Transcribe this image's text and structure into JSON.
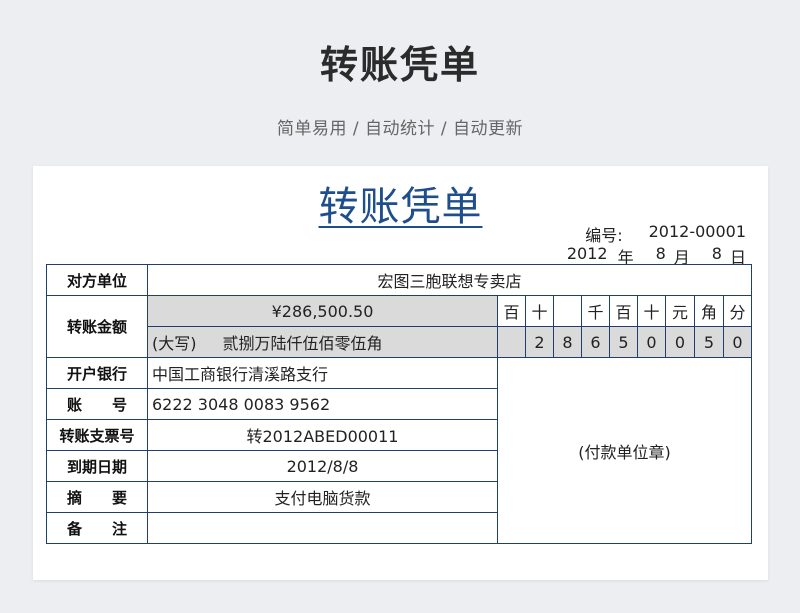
{
  "header": {
    "title": "转账凭单",
    "subtitle": "简单易用 / 自动统计 / 自动更新"
  },
  "voucher": {
    "title": "转账凭单",
    "number_label": "编号:",
    "number": "2012-00001",
    "date": {
      "year": "2012",
      "year_label": "年",
      "month": "8",
      "month_label": "月",
      "day": "8",
      "day_label": "日"
    }
  },
  "form": {
    "counterparty_label": "对方单位",
    "counterparty": "宏图三胞联想专卖店",
    "amount_label": "转账金额",
    "amount": "¥286,500.50",
    "amount_upper_label": "(大写)",
    "amount_upper": "贰捌万陆仟伍佰零伍角",
    "digit_headers": [
      "百",
      "十",
      "",
      "千",
      "百",
      "十",
      "元",
      "角",
      "分"
    ],
    "digits": [
      "",
      "2",
      "8",
      "6",
      "5",
      "0",
      "0",
      "5",
      "0"
    ],
    "bank_label": "开户银行",
    "bank": "中国工商银行清溪路支行",
    "account_label": "账　　号",
    "account": "6222 3048 0083 9562",
    "check_label": "转账支票号",
    "check_no": "转2012ABED00011",
    "due_label": "到期日期",
    "due_date": "2012/8/8",
    "summary_label": "摘　　要",
    "summary": "支付电脑货款",
    "remark_label": "备　　注",
    "remark": "",
    "stamp": "(付款单位章)"
  }
}
